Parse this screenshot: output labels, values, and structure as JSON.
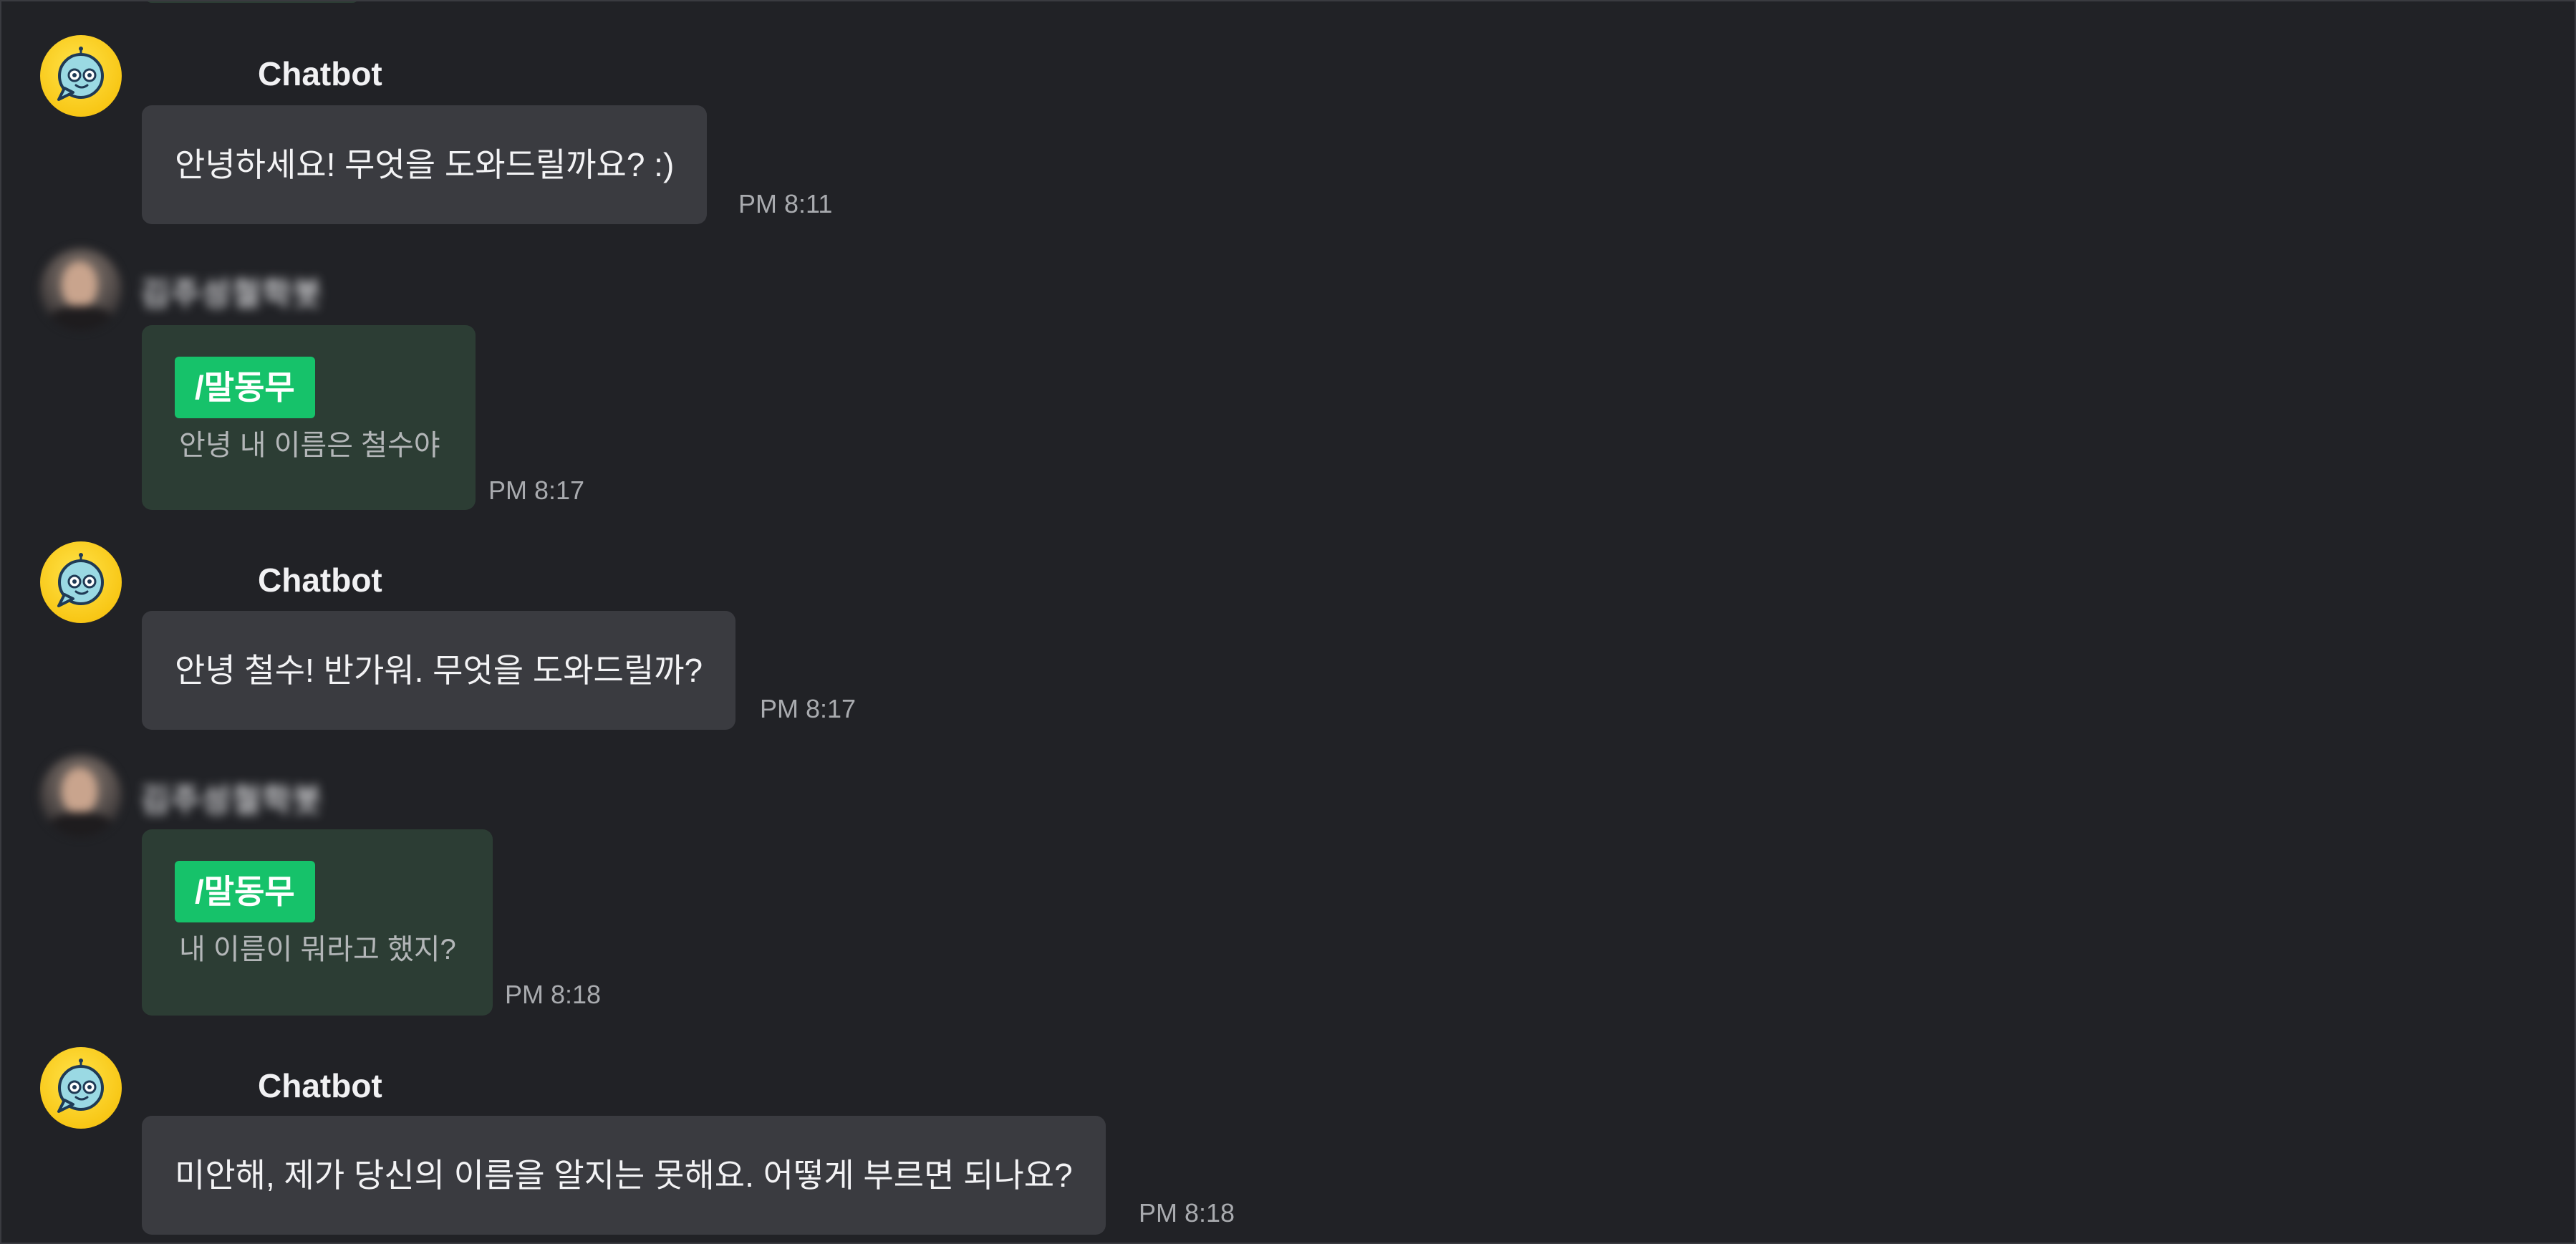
{
  "colors": {
    "background": "#212226",
    "bot_bubble": "#3a3b40",
    "user_bubble": "#2c3d34",
    "command_badge": "#16c26a",
    "bot_avatar": "#f8c716"
  },
  "messages": [
    {
      "role": "bot",
      "sender": "Chatbot",
      "avatar_icon": "chatbot-avatar-icon",
      "text": "안녕하세요! 무엇을 도와드릴까요?  :)",
      "time": "PM 8:11"
    },
    {
      "role": "user",
      "sender": "김주성철학봇",
      "avatar_icon": "user-avatar-photo",
      "command": "/말동무",
      "text": "안녕 내 이름은 철수야",
      "time": "PM 8:17"
    },
    {
      "role": "bot",
      "sender": "Chatbot",
      "avatar_icon": "chatbot-avatar-icon",
      "text": "안녕 철수! 반가워. 무엇을 도와드릴까?",
      "time": "PM 8:17"
    },
    {
      "role": "user",
      "sender": "김주성철학봇",
      "avatar_icon": "user-avatar-photo",
      "command": "/말동무",
      "text": "내 이름이 뭐라고 했지?",
      "time": "PM 8:18"
    },
    {
      "role": "bot",
      "sender": "Chatbot",
      "avatar_icon": "chatbot-avatar-icon",
      "text": "미안해, 제가 당신의 이름을 알지는 못해요. 어떻게 부르면 되나요?",
      "time": "PM 8:18"
    }
  ]
}
